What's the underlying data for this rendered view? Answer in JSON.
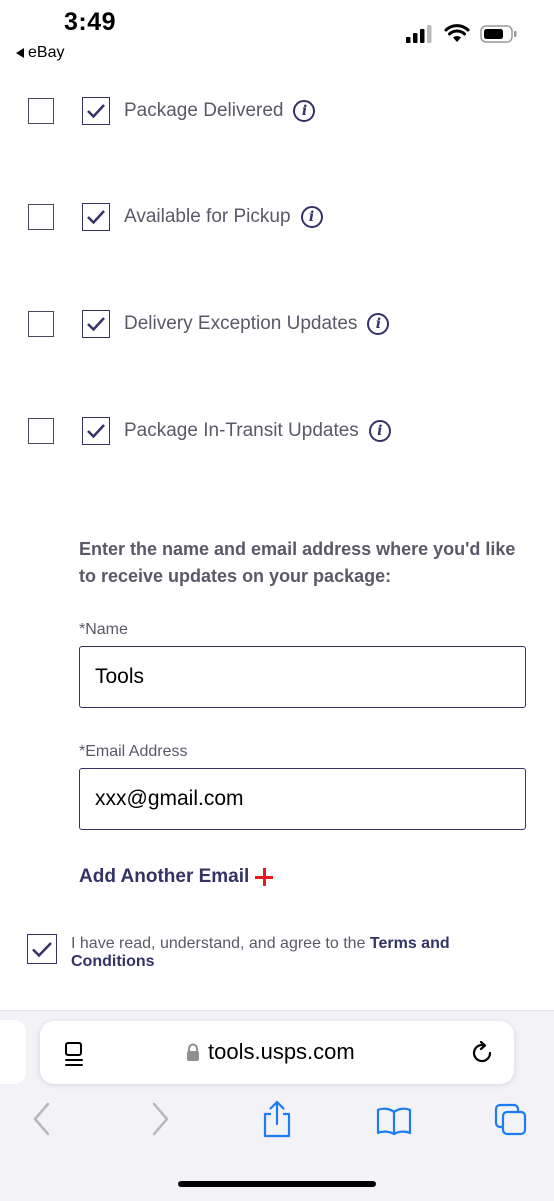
{
  "status_bar": {
    "time": "3:49",
    "back_label": "eBay"
  },
  "notifications": [
    {
      "label": "Package Delivered"
    },
    {
      "label": "Available for Pickup"
    },
    {
      "label": "Delivery Exception Updates"
    },
    {
      "label": "Package In-Transit Updates"
    }
  ],
  "form": {
    "intro": "Enter the name and email address where you'd like to receive updates on your package:",
    "name_label": "*Name",
    "name_value": "Tools",
    "email_label": "*Email Address",
    "email_value": "xxx@gmail.com",
    "add_email_label": "Add Another Email",
    "agree_prefix": "I have read, understand, and agree to the ",
    "agree_link": "Terms and Conditions",
    "agree_checked": true
  },
  "browser": {
    "url": "tools.usps.com"
  },
  "colors": {
    "brand_navy": "#333366",
    "accent_red": "#e71921",
    "text_gray": "#595968"
  }
}
